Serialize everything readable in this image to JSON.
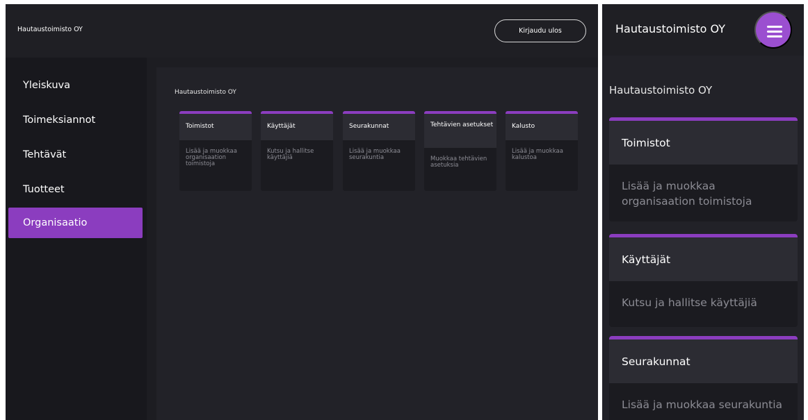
{
  "desktop": {
    "header": {
      "org_name": "Hautaustoimisto OY",
      "logout_label": "Kirjaudu ulos"
    },
    "sidebar": {
      "items": [
        {
          "label": "Yleiskuva",
          "active": false
        },
        {
          "label": "Toimeksiannot",
          "active": false
        },
        {
          "label": "Tehtävät",
          "active": false
        },
        {
          "label": "Tuotteet",
          "active": false
        },
        {
          "label": "Organisaatio",
          "active": true
        }
      ]
    },
    "main": {
      "title": "Hautaustoimisto OY",
      "cards": [
        {
          "title": "Toimistot",
          "description": "Lisää ja muokkaa organisaation toimistoja"
        },
        {
          "title": "Käyttäjät",
          "description": "Kutsu ja hallitse käyttäjiä"
        },
        {
          "title": "Seurakunnat",
          "description": "Lisää ja muokkaa seurakuntia"
        },
        {
          "title": "Tehtävien asetukset",
          "description": "Muokkaa tehtävien asetuksia"
        },
        {
          "title": "Kalusto",
          "description": "Lisää ja muokkaa kalustoa"
        }
      ]
    }
  },
  "mobile": {
    "header": {
      "org_name": "Hautaustoimisto OY",
      "menu_icon": "hamburger-icon"
    },
    "main": {
      "title": "Hautaustoimisto OY",
      "cards": [
        {
          "title": "Toimistot",
          "description": "Lisää ja muokkaa organisaation toimistoja"
        },
        {
          "title": "Käyttäjät",
          "description": "Kutsu ja hallitse käyttäjiä"
        },
        {
          "title": "Seurakunnat",
          "description": "Lisää ja muokkaa seurakuntia"
        }
      ]
    }
  },
  "colors": {
    "accent": "#8b3dbf",
    "menu_button": "#9b4fd0",
    "background": "#1d1d22",
    "card_header": "#2c2c33",
    "muted_text": "#8c8c94"
  }
}
